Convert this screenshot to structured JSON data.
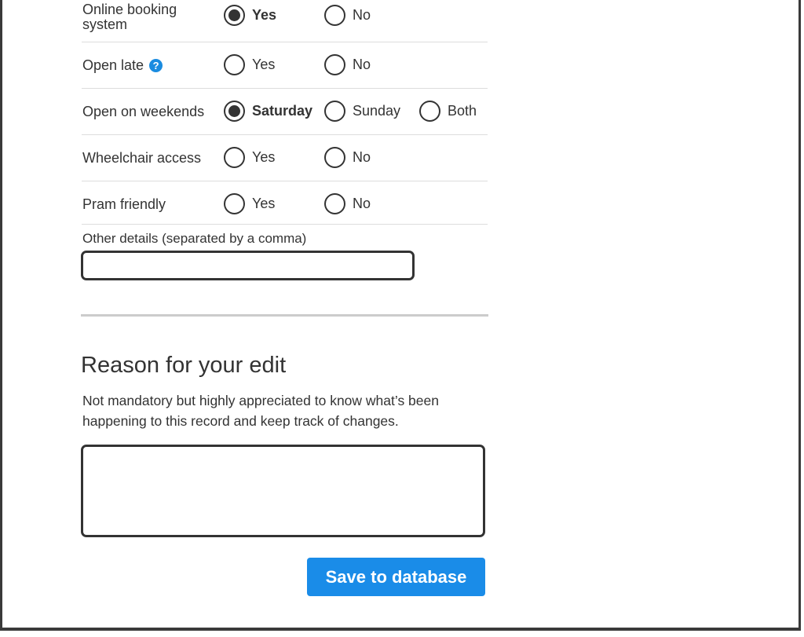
{
  "form": {
    "rows": [
      {
        "label": "Online booking system",
        "options": [
          {
            "label": "Yes",
            "checked": true
          },
          {
            "label": "No",
            "checked": false
          }
        ]
      },
      {
        "label": "Open late",
        "help_icon": "question-icon",
        "options": [
          {
            "label": "Yes",
            "checked": false
          },
          {
            "label": "No",
            "checked": false
          }
        ]
      },
      {
        "label": "Open on weekends",
        "options": [
          {
            "label": "Saturday",
            "checked": true
          },
          {
            "label": "Sunday",
            "checked": false
          },
          {
            "label": "Both",
            "checked": false
          }
        ]
      },
      {
        "label": "Wheelchair access",
        "options": [
          {
            "label": "Yes",
            "checked": false
          },
          {
            "label": "No",
            "checked": false
          }
        ]
      },
      {
        "label": "Pram friendly",
        "options": [
          {
            "label": "Yes",
            "checked": false
          },
          {
            "label": "No",
            "checked": false
          }
        ]
      }
    ],
    "other_details": {
      "label": "Other details (separated by a comma)",
      "value": ""
    }
  },
  "reason": {
    "title": "Reason for your edit",
    "description": "Not mandatory but highly appreciated to know what’s been happening to this record and keep track of changes.",
    "value": ""
  },
  "actions": {
    "save_label": "Save to database"
  },
  "colors": {
    "accent": "#1a8ce8",
    "text": "#333333",
    "divider": "#cccccc"
  }
}
